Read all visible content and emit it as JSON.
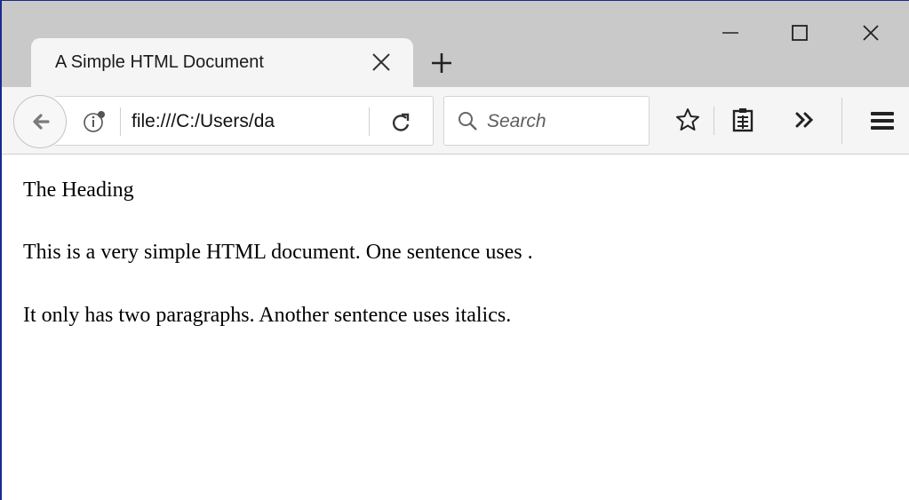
{
  "tab": {
    "title": "A Simple HTML Document"
  },
  "toolbar": {
    "url": "file:///C:/Users/da",
    "search_placeholder": "Search"
  },
  "icons": {
    "tab_close": "close-icon",
    "new_tab": "plus-icon",
    "minimize": "minimize-icon",
    "maximize": "maximize-icon",
    "close_window": "close-icon",
    "back": "back-arrow-icon",
    "site_info": "info-icon",
    "reload": "reload-icon",
    "search": "search-icon",
    "bookmark": "star-icon",
    "reader": "clipboard-icon",
    "overflow": "chevron-double-right-icon",
    "menu": "hamburger-menu-icon"
  },
  "page": {
    "heading": "The Heading",
    "paragraph_1": "This is a very simple HTML document. One sentence uses .",
    "paragraph_2": "It only has two paragraphs. Another sentence uses italics."
  },
  "colors": {
    "window_border": "#1a2a8c",
    "tabstrip_bg": "#c9c9c9",
    "toolbar_bg": "#f5f5f5"
  }
}
